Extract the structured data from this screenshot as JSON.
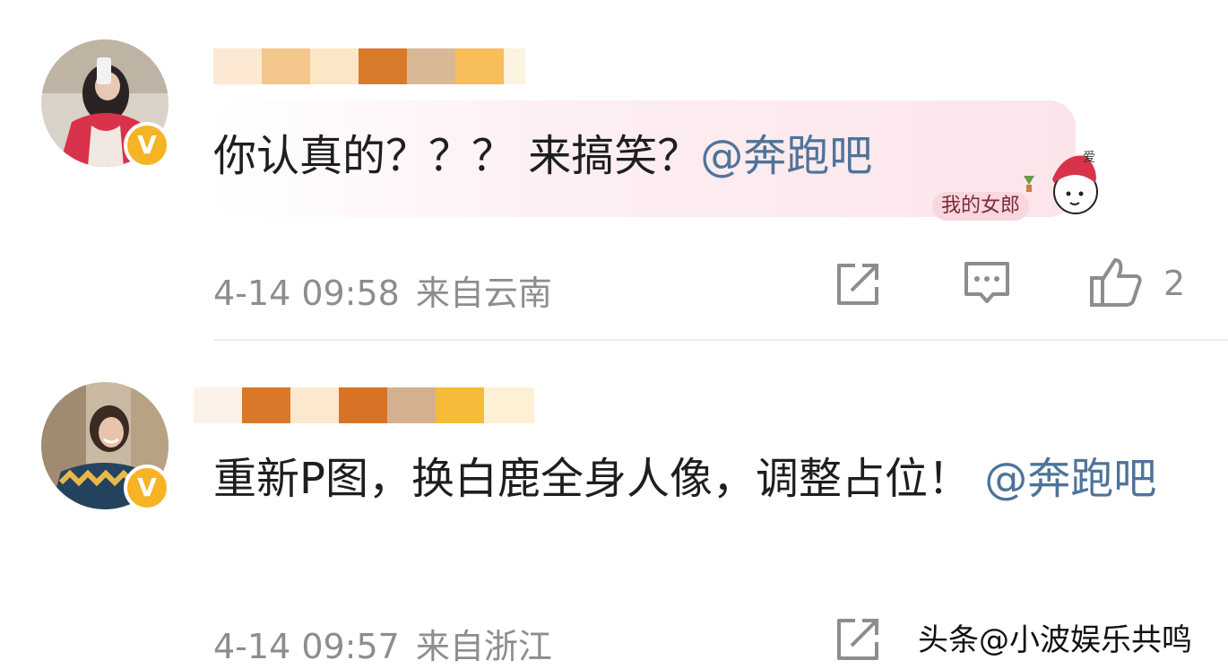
{
  "comments": [
    {
      "username": "",
      "username_censored": true,
      "text": "你认真的？？？ 来搞笑？",
      "mention": "@奔跑吧",
      "time": "4-14 09:58",
      "location": "来自云南",
      "likes": "2",
      "verified_badge": "V",
      "bubble_tag": "我的女郎"
    },
    {
      "username": "",
      "username_censored": true,
      "text": "重新P图，换白鹿全身人像，调整占位！",
      "mention": "@奔跑吧",
      "time": "4-14 09:57",
      "location": "来自浙江",
      "verified_badge": "V"
    }
  ],
  "icons": {
    "share": "share-icon",
    "comment": "comment-icon",
    "like": "thumbs-up-icon"
  },
  "watermark": "头条@小波娱乐共鸣",
  "colors": {
    "mention": "#4f7399",
    "meta": "#8d8d8d",
    "badge": "#f6b323"
  }
}
